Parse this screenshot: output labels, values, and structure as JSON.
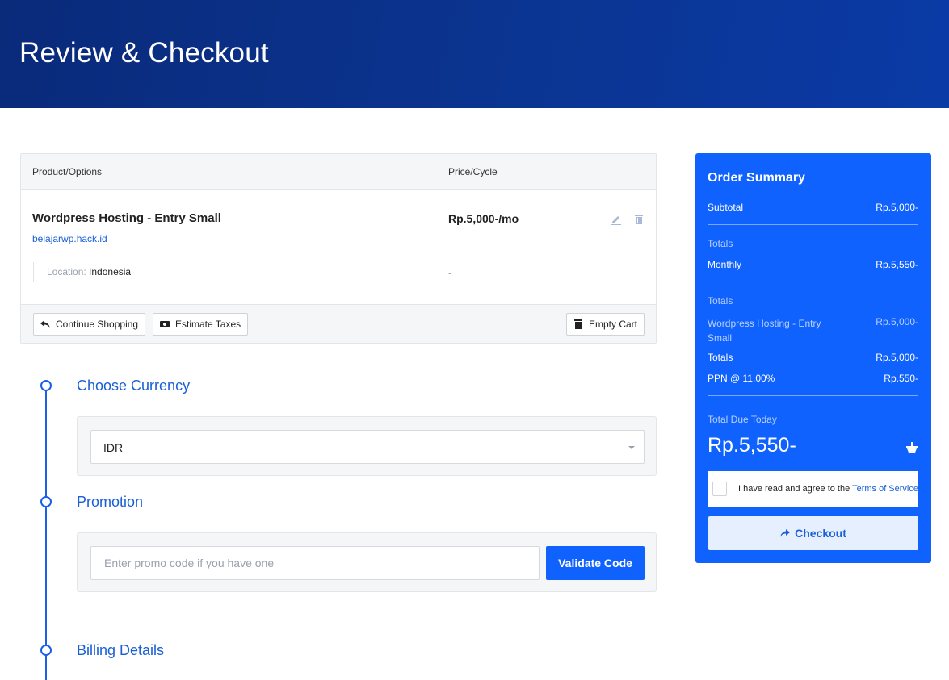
{
  "header": {
    "title": "Review & Checkout"
  },
  "cart": {
    "columns": {
      "product": "Product/Options",
      "price": "Price/Cycle"
    },
    "item": {
      "name": "Wordpress Hosting - Entry Small",
      "domain": "belajarwp.hack.id",
      "option_label": "Location:",
      "option_value": "Indonesia",
      "price": "Rp.5,000-/mo",
      "option_price": "-"
    },
    "actions": {
      "continue_shopping": "Continue Shopping",
      "estimate_taxes": "Estimate Taxes",
      "empty_cart": "Empty Cart"
    }
  },
  "sections": {
    "currency": {
      "title": "Choose Currency",
      "selected": "IDR"
    },
    "promotion": {
      "title": "Promotion",
      "placeholder": "Enter promo code if you have one",
      "button": "Validate Code"
    },
    "billing": {
      "title": "Billing Details"
    }
  },
  "summary": {
    "title": "Order Summary",
    "subtotal_label": "Subtotal",
    "subtotal_value": "Rp.5,000-",
    "totals_label_1": "Totals",
    "monthly_label": "Monthly",
    "monthly_value": "Rp.5,550-",
    "totals_label_2": "Totals",
    "item_label": "Wordpress Hosting - Entry Small",
    "item_value": "Rp.5,000-",
    "totals_row_label": "Totals",
    "totals_row_value": "Rp.5,000-",
    "tax_label": "PPN @ 11.00%",
    "tax_value": "Rp.550-",
    "due_label": "Total Due Today",
    "due_value": "Rp.5,550-",
    "tos_text": "I have read and agree to the",
    "tos_link": "Terms of Service",
    "checkout_button": "Checkout"
  },
  "colors": {
    "primary": "#1062fe",
    "header": "#0b3592",
    "link": "#1a5fd6"
  }
}
